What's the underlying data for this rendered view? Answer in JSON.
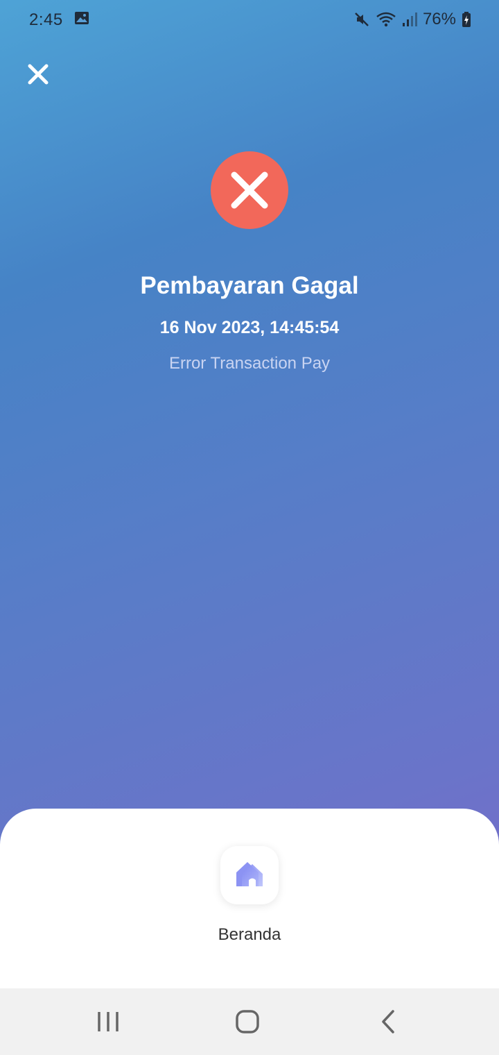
{
  "status_bar": {
    "time": "2:45",
    "battery_percent": "76%",
    "icons": [
      "gallery-icon",
      "mute-icon",
      "wifi-icon",
      "signal-icon",
      "battery-charging-icon"
    ]
  },
  "header": {
    "close_icon": "close-icon"
  },
  "result": {
    "status_icon": "error-x-icon",
    "status_color": "#f2685a",
    "title": "Pembayaran Gagal",
    "datetime": "16 Nov 2023, 14:45:54",
    "message": "Error Transaction Pay"
  },
  "bottom_sheet": {
    "home_icon": "home-icon",
    "home_label": "Beranda"
  },
  "nav_bar": {
    "icons": [
      "recents-icon",
      "home-circle-icon",
      "back-icon"
    ]
  },
  "colors": {
    "gradient_top": "#4ea3d6",
    "gradient_bottom": "#7b69c9",
    "accent_home": "#8b8cf0"
  }
}
